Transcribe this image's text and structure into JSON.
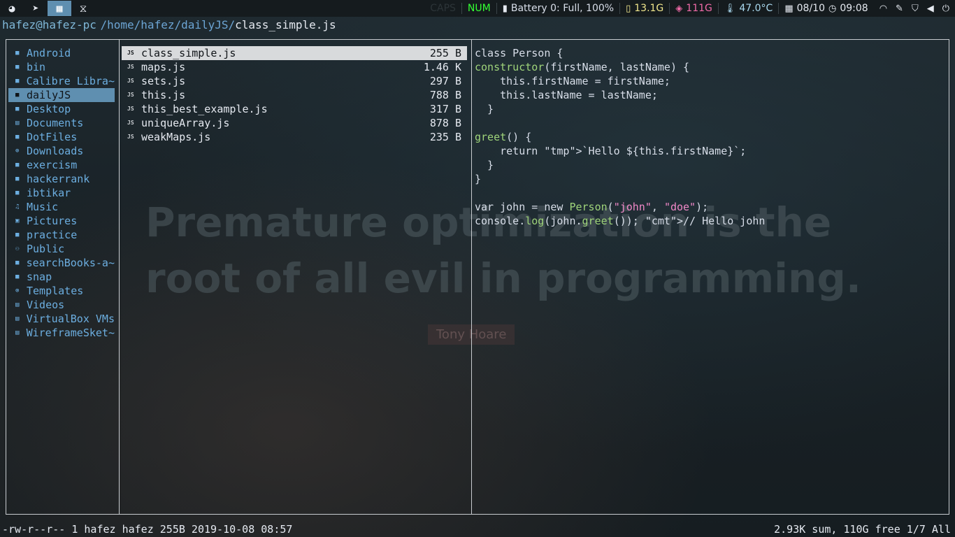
{
  "topbar": {
    "workspaces": [
      {
        "name": "firefox-icon",
        "glyph": "◕"
      },
      {
        "name": "telegram-icon",
        "glyph": "➤"
      },
      {
        "name": "grid-icon",
        "glyph": "▦",
        "active": true
      },
      {
        "name": "vscode-icon",
        "glyph": "⧖"
      }
    ],
    "caps": "CAPS",
    "num": "NUM",
    "battery": "Battery 0: Full, 100%",
    "ram": "13.1G",
    "disk": "111G",
    "temp": "47.0°C",
    "date": "08/10",
    "time": "09:08"
  },
  "path": {
    "user": "hafez@hafez-pc",
    "dir": "/home/hafez/dailyJS/",
    "file": "class_simple.js"
  },
  "dirs": [
    "Android",
    "bin",
    "Calibre Libra~",
    "dailyJS",
    "Desktop",
    "Documents",
    "DotFiles",
    "Downloads",
    "exercism",
    "hackerrank",
    "ibtikar",
    "Music",
    "Pictures",
    "practice",
    "Public",
    "searchBooks-a~",
    "snap",
    "Templates",
    "Videos",
    "VirtualBox VMs",
    "WireframeSket~"
  ],
  "files": [
    {
      "name": "class_simple.js",
      "size": "255 B",
      "type": "JS"
    },
    {
      "name": "maps.js",
      "size": "1.46 K",
      "type": "JS"
    },
    {
      "name": "sets.js",
      "size": "297 B",
      "type": "JS"
    },
    {
      "name": "this.js",
      "size": "788 B",
      "type": "JS"
    },
    {
      "name": "this_best_example.js",
      "size": "317 B",
      "type": "JS"
    },
    {
      "name": "uniqueArray.js",
      "size": "878 B",
      "type": "JS"
    },
    {
      "name": "weakMaps.js",
      "size": "235 B",
      "type": "JS"
    }
  ],
  "code_lines": [
    "class Person {",
    "  constructor(firstName, lastName) {",
    "    this.firstName = firstName;",
    "    this.lastName = lastName;",
    "  }",
    "",
    "  greet() {",
    "    return `Hello ${this.firstName}`;",
    "  }",
    "}",
    "",
    "var john = new Person(\"john\", \"doe\");",
    "console.log(john.greet()); // Hello john"
  ],
  "wallpaper": {
    "quote_line1": "Premature optimization is the",
    "quote_line2": "root of all evil in programming.",
    "author": "Tony Hoare"
  },
  "status": {
    "left": "-rw-r--r-- 1 hafez hafez 255B 2019-10-08 08:57",
    "right": "2.93K sum, 110G free  1/7   All"
  },
  "colors": {
    "accent": "#5f8fb0",
    "dir": "#6caee0",
    "num": "#33ff33",
    "string": "#f088c8",
    "function": "#9fd47a"
  }
}
